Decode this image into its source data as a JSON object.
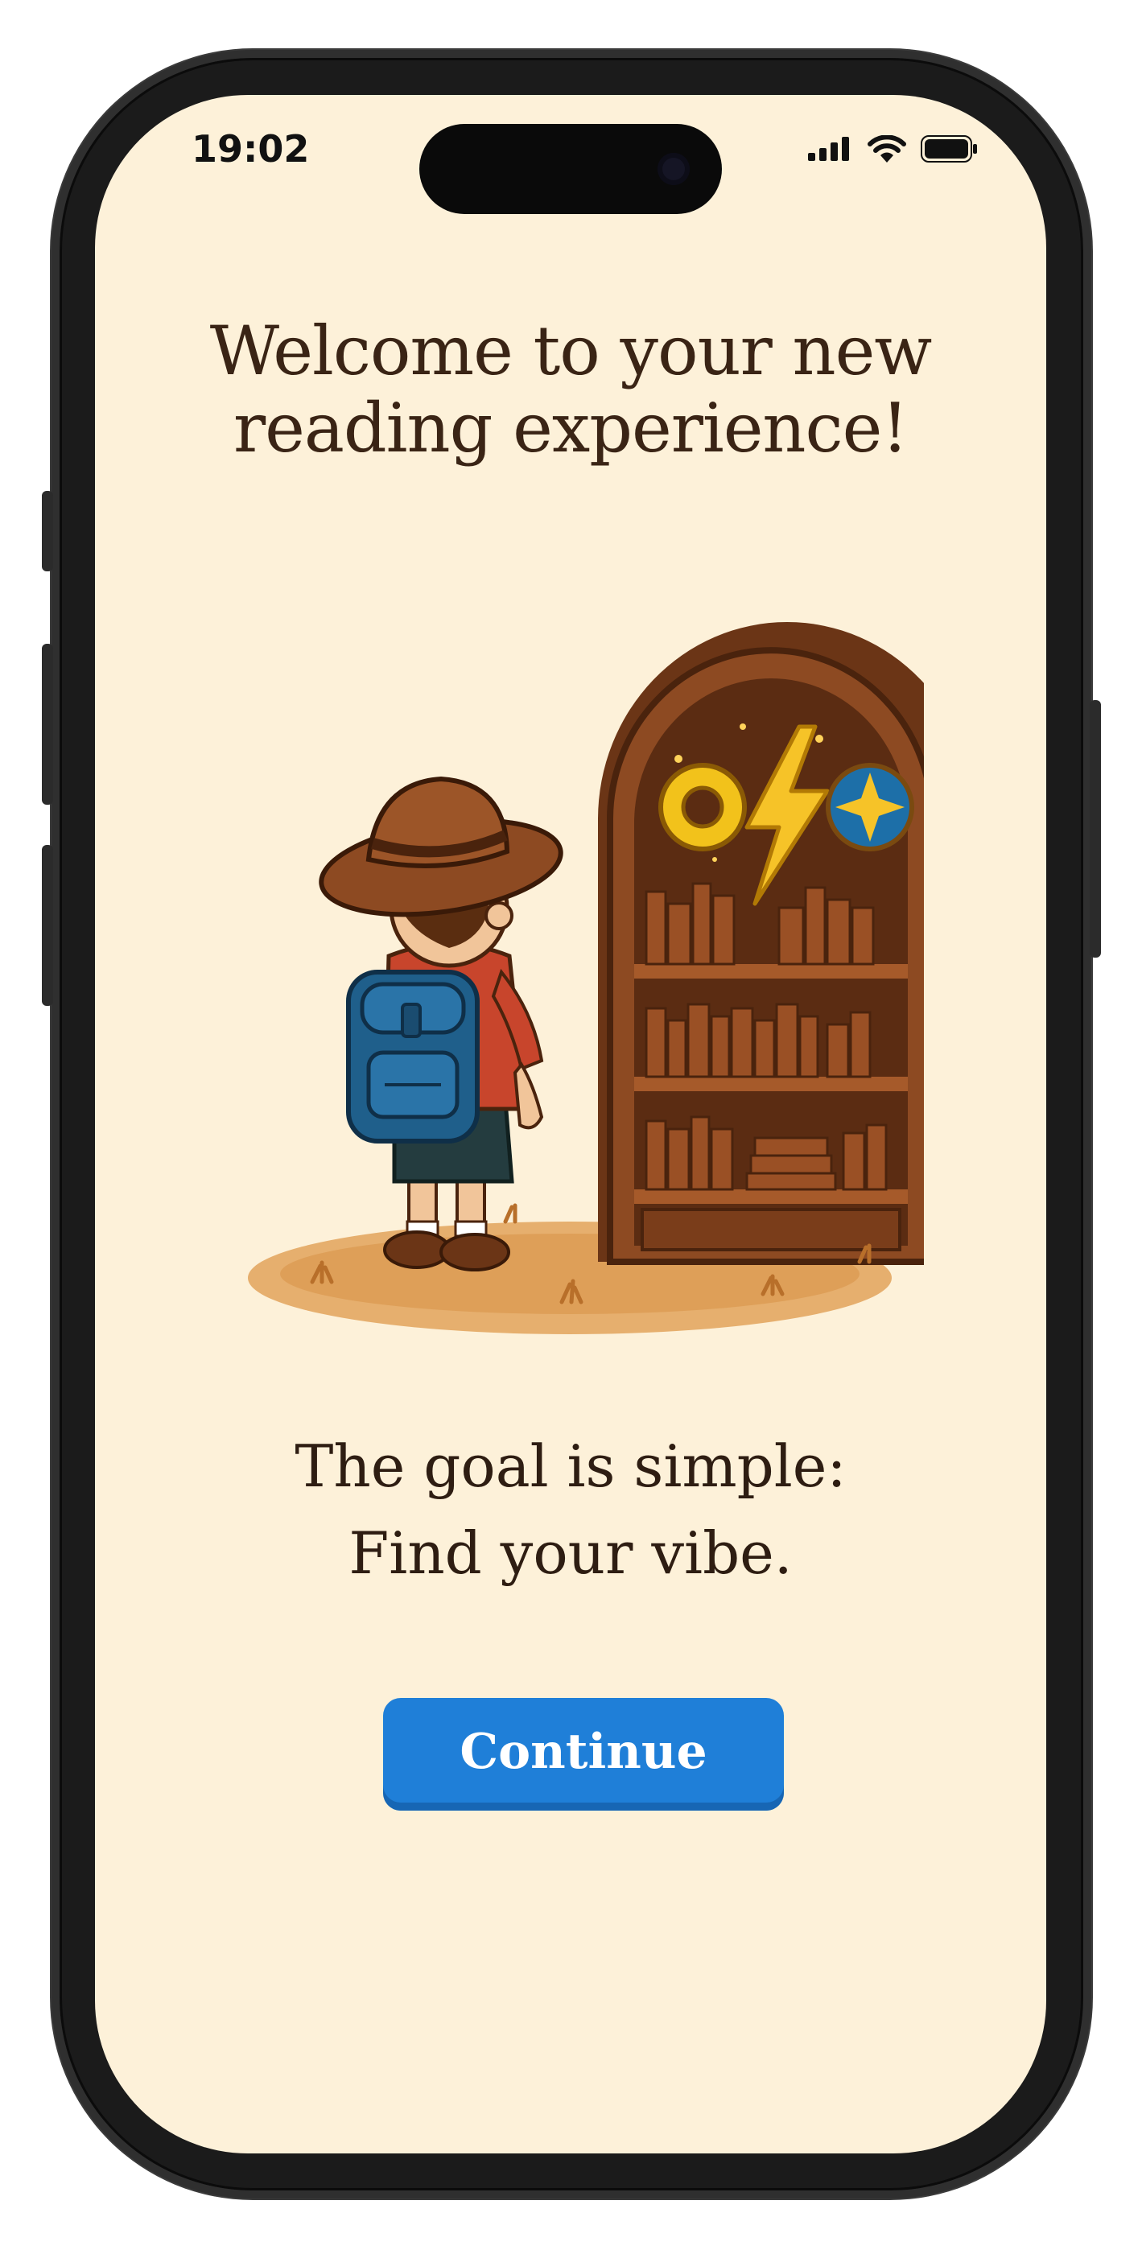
{
  "status_bar": {
    "time": "19:02",
    "icons": [
      "signal-icon",
      "wifi-icon",
      "battery-icon"
    ]
  },
  "welcome": {
    "title_line1": "Welcome to your new",
    "title_line2": "reading experience!"
  },
  "illustration": {
    "subject": "explorer-and-bookcase-illustration",
    "badges": [
      "ring-icon",
      "lightning-icon",
      "star-icon"
    ]
  },
  "tagline": {
    "line1": "The goal is simple:",
    "line2": "Find your vibe."
  },
  "actions": {
    "continue_label": "Continue"
  },
  "colors": {
    "background": "#fdf1d9",
    "text": "#3a2415",
    "button": "#1f7fd8",
    "button_text": "#ffffff"
  }
}
